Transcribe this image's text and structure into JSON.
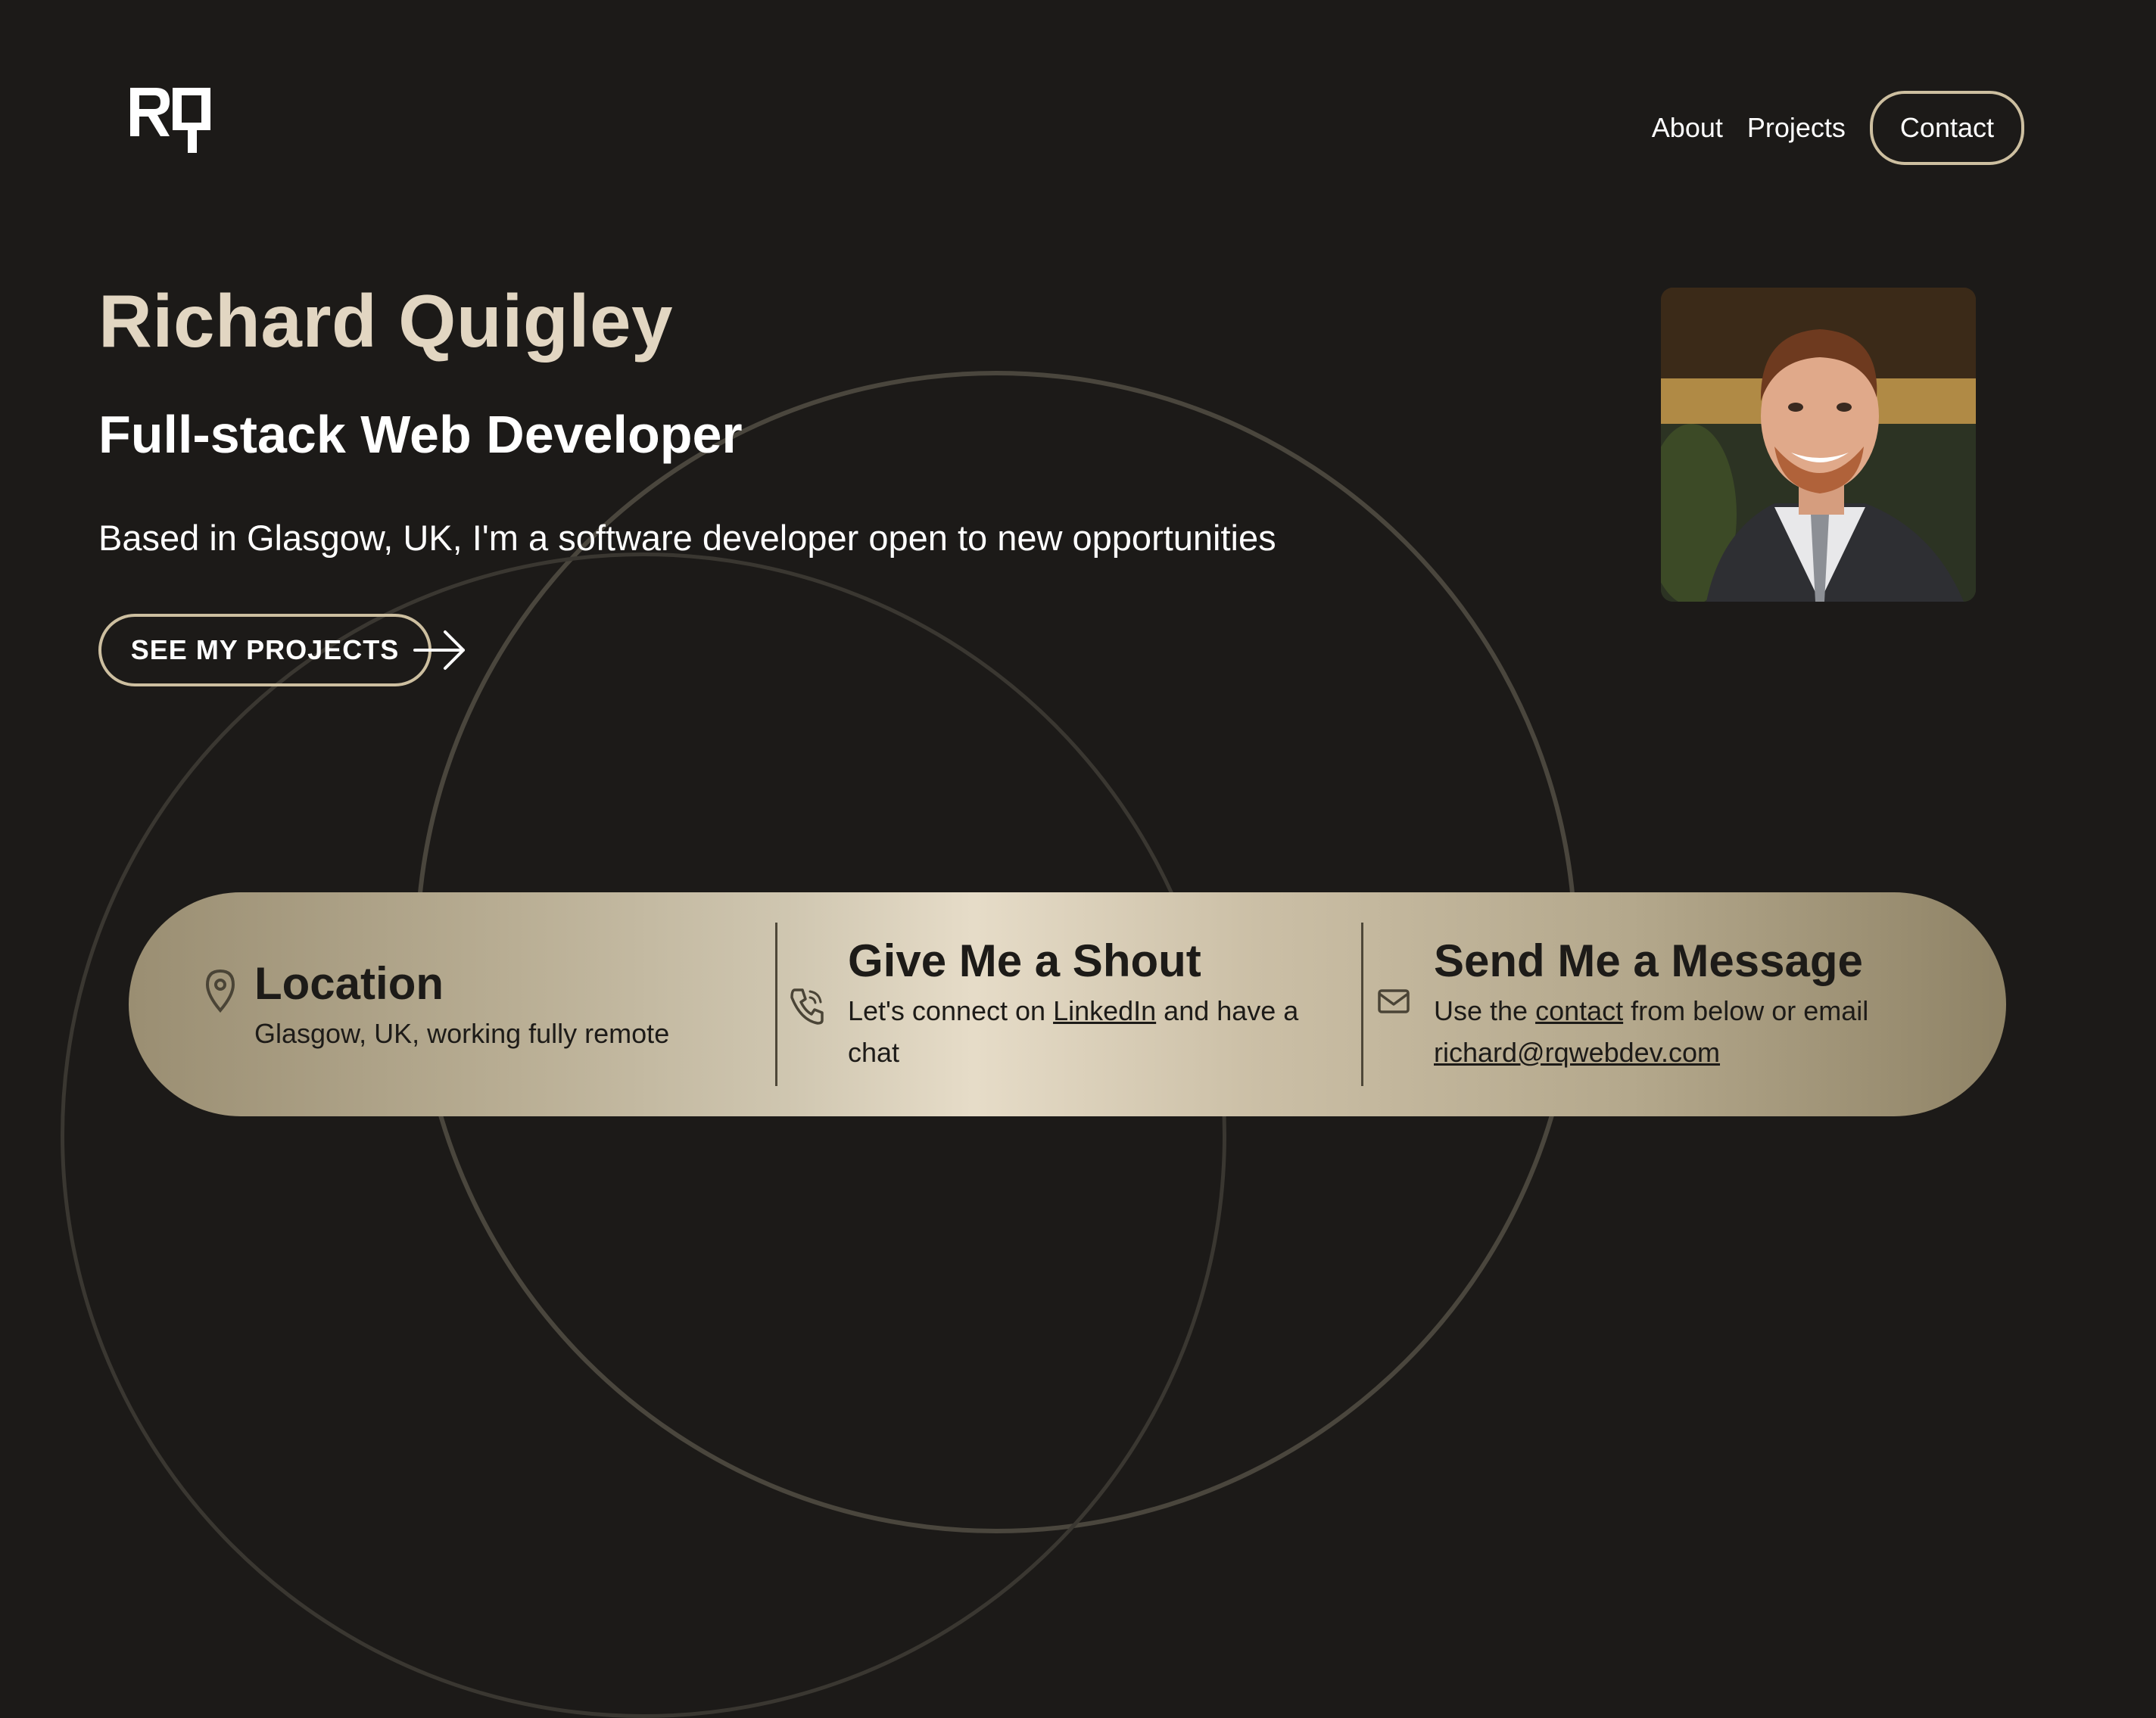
{
  "logo": {
    "text": "RQ"
  },
  "nav": {
    "about": "About",
    "projects": "Projects",
    "contact": "Contact"
  },
  "hero": {
    "name": "Richard Quigley",
    "role": "Full-stack Web Developer",
    "tagline": "Based in Glasgow, UK, I'm a software developer open to new opportunities",
    "cta": "SEE MY PROJECTS"
  },
  "info_bar": {
    "location": {
      "title": "Location",
      "text": "Glasgow, UK, working fully remote"
    },
    "shout": {
      "title": "Give Me a Shout",
      "pre": "Let's connect on ",
      "link": "LinkedIn",
      "post": " and have a chat"
    },
    "message": {
      "title": "Send Me a Message",
      "pre": "Use the ",
      "link": "contact",
      "post": " from below or email ",
      "email": "richard@rqwebdev.com"
    }
  },
  "colors": {
    "background": "#1c1a18",
    "accent": "#cdbfa0",
    "name_color": "#e2d6c2",
    "bar_mid": "#e6dcc8",
    "bar_edge": "#9a8e72"
  }
}
